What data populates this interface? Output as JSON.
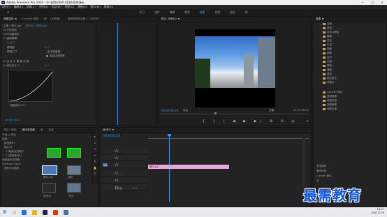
{
  "titlebar": {
    "logo": "Pr",
    "title": "Adobe Premiere Pro 2020 - D:\\视频\\0001\\案例\\案例演示",
    "min": "—",
    "max": "□",
    "close": "✕"
  },
  "menu": [
    "文件(F)",
    "编辑(E)",
    "剪辑(C)",
    "序列(S)",
    "标记(M)",
    "图形(G)",
    "视图(V)",
    "窗口(W)",
    "帮助(H)"
  ],
  "workspaces": {
    "home": "⌂",
    "items": [
      "学习",
      "组件",
      "编辑",
      "颜色",
      "效果",
      "音频",
      "图形",
      "库"
    ],
    "active_index": 4
  },
  "effect_controls": {
    "tabs": [
      "效果控件 ≡",
      "Lumetri 范围",
      "源：（无剪辑）",
      "音频剪辑混合器：（无序列）"
    ],
    "source": "主要 * 图片.jpg",
    "seq": "序列01 * 图片.jpg",
    "time": "00:00",
    "rows": [
      "fx 不透明度",
      "fx 时间重映射",
      "fx 高斯模糊",
      "模糊度",
      "模糊尺寸",
      "重复边缘像素",
      "fx 自 定 义 模 糊 效 果",
      "fx 颜色校正 %"
    ],
    "blur_value": "0.0",
    "option": "水平和垂直",
    "checkbox_label": "重复边缘像素",
    "velocity_label": "速度曲线 0.0"
  },
  "program": {
    "tab": "节目：序列01 ≡",
    "timecode": "00:00:03:21",
    "fit": "适合",
    "quality": "完整",
    "duration": "00:00:08:00"
  },
  "project": {
    "tabs": [
      "项目：案例",
      "媒体浏览器",
      "库",
      "信息"
    ],
    "path": "本地 > 项目",
    "items": [
      "视频",
      "新视频01",
      "图片01",
      "C:桌面\\光线展示",
      "C:\\视频素材01",
      "网络媒体浏览器",
      "Creative Cloud",
      "团队项目服务"
    ],
    "thumbs": [
      {
        "name": "图片.jpg",
        "dur": "5:00"
      },
      {
        "name": "图片",
        "dur": "3:00"
      },
      {
        "name": "序列01",
        "dur": "3:00"
      },
      {
        "name": "音乐",
        "dur": "5:00"
      }
    ]
  },
  "timeline": {
    "tab": "序列01 ≡",
    "timecode": "00:00:03:21",
    "tracks": [
      "V3",
      "V2",
      "V1",
      "A1",
      "A2",
      "A3"
    ],
    "clip": "图片.jpg",
    "master": "主声道",
    "master_value": "0.0"
  },
  "effects_panel": {
    "title": "效果 ≡",
    "items": [
      "变换",
      "扭曲",
      "杂色与颗粒",
      "模糊",
      "锐化",
      "生成",
      "视频",
      "调整",
      "过时",
      "过渡",
      "透视",
      "通道",
      "键控",
      "颜色校正",
      "风格化",
      "Lumetri 预设",
      "音频效果",
      "音频过渡",
      "视频效果",
      "视频过渡"
    ],
    "bottom": [
      "基本图形",
      "基本声音",
      "Lumetri 颜色",
      "库",
      "标记",
      "历史记录",
      "信息"
    ]
  },
  "taskbar": {
    "time": "16:27",
    "date": "2021/11/9"
  },
  "watermark": "最需教育"
}
